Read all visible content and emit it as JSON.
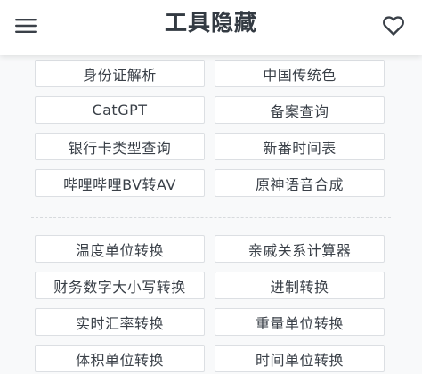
{
  "header": {
    "title": "工具隐藏"
  },
  "icons": {
    "menu": "hamburger-menu-icon",
    "favorite": "heart-outline-icon"
  },
  "colors": {
    "header_bg": "#ffffff",
    "page_bg": "#f8f9fa",
    "text": "#3a4048",
    "border": "#dcdfe3"
  },
  "groups": [
    {
      "items": [
        "身份证解析",
        "中国传统色",
        "CatGPT",
        "备案查询",
        "银行卡类型查询",
        "新番时间表",
        "哔哩哔哩BV转AV",
        "原神语音合成"
      ]
    },
    {
      "items": [
        "温度单位转换",
        "亲戚关系计算器",
        "财务数字大小写转换",
        "进制转换",
        "实时汇率转换",
        "重量单位转换",
        "体积单位转换",
        "时间单位转换"
      ]
    }
  ]
}
